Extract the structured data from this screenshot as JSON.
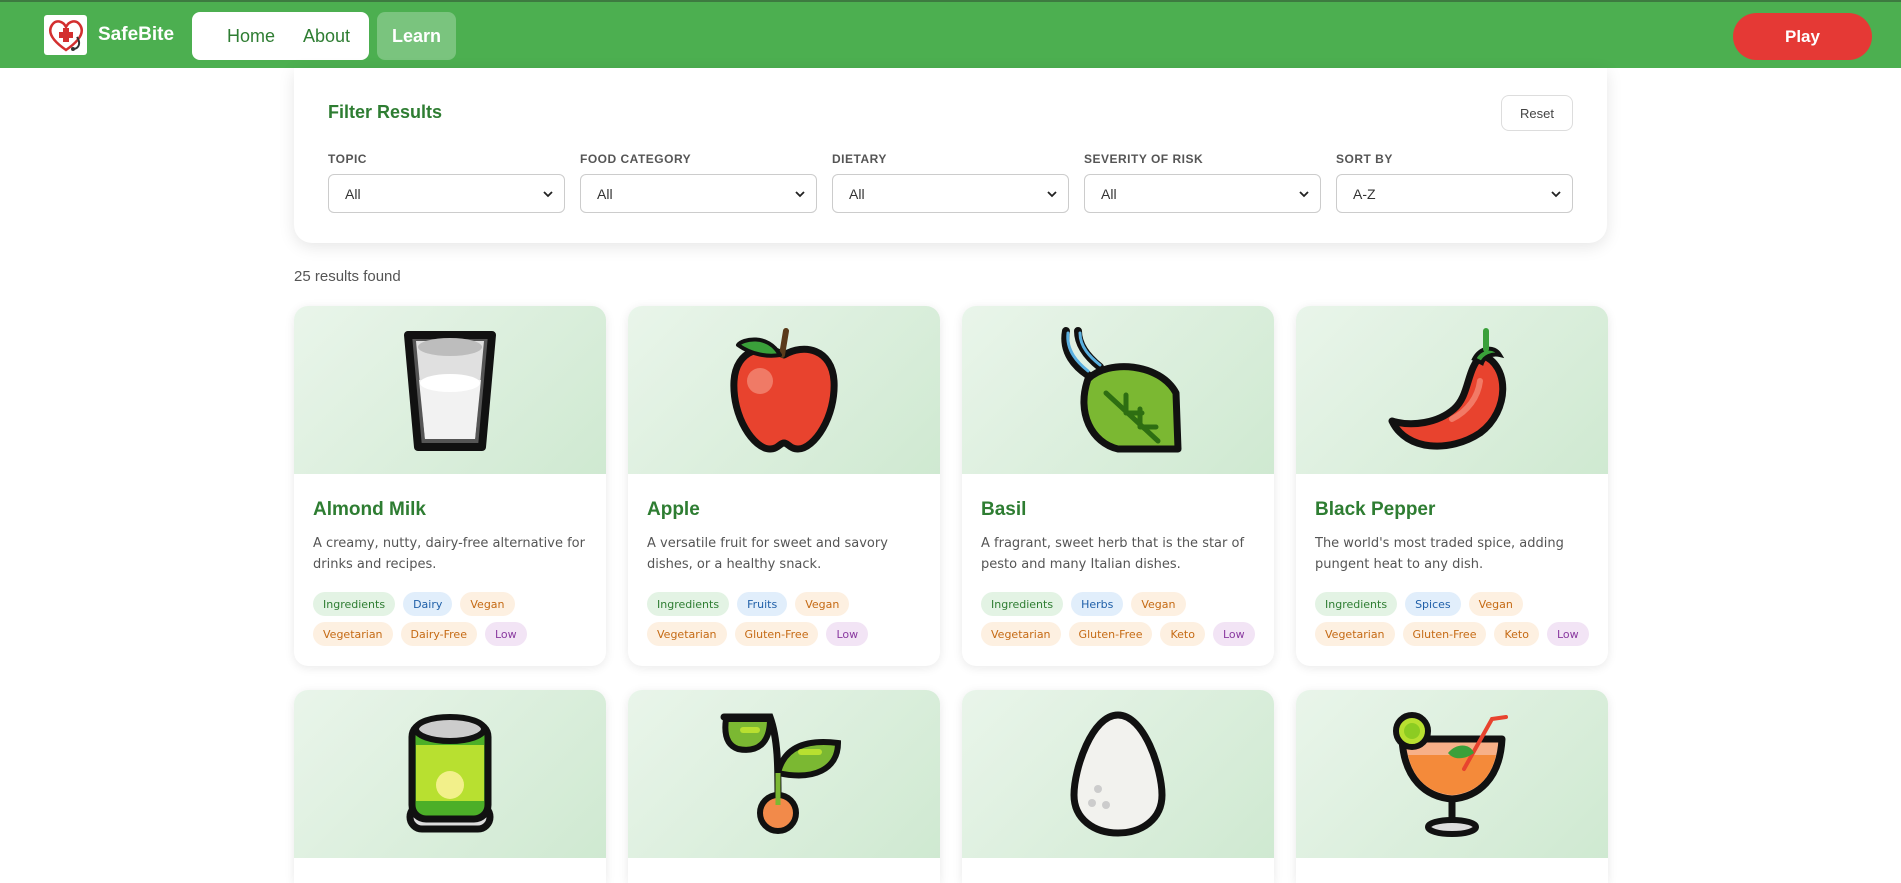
{
  "nav": {
    "brand": "SafeBite",
    "home": "Home",
    "about": "About",
    "learn": "Learn",
    "play": "Play"
  },
  "filters": {
    "title": "Filter Results",
    "reset": "Reset",
    "groups": [
      {
        "label": "TOPIC",
        "value": "All"
      },
      {
        "label": "FOOD CATEGORY",
        "value": "All"
      },
      {
        "label": "DIETARY",
        "value": "All"
      },
      {
        "label": "SEVERITY OF RISK",
        "value": "All"
      },
      {
        "label": "SORT BY",
        "value": "A-Z"
      }
    ]
  },
  "results": {
    "count_text": "25 results found"
  },
  "cards": [
    {
      "title": "Almond Milk",
      "desc": "A creamy, nutty, dairy-free alternative for drinks and recipes.",
      "tags": [
        "Ingredients",
        "Dairy",
        "Vegan",
        "Vegetarian",
        "Dairy-Free",
        "Low"
      ],
      "icon": "milk-glass-icon"
    },
    {
      "title": "Apple",
      "desc": "A versatile fruit for sweet and savory dishes, or a healthy snack.",
      "tags": [
        "Ingredients",
        "Fruits",
        "Vegan",
        "Vegetarian",
        "Gluten-Free",
        "Low"
      ],
      "icon": "apple-icon"
    },
    {
      "title": "Basil",
      "desc": "A fragrant, sweet herb that is the star of pesto and many Italian dishes.",
      "tags": [
        "Ingredients",
        "Herbs",
        "Vegan",
        "Vegetarian",
        "Gluten-Free",
        "Keto",
        "Low"
      ],
      "icon": "herb-leaf-icon"
    },
    {
      "title": "Black Pepper",
      "desc": "The world's most traded spice, adding pungent heat to any dish.",
      "tags": [
        "Ingredients",
        "Spices",
        "Vegan",
        "Vegetarian",
        "Gluten-Free",
        "Keto",
        "Low"
      ],
      "icon": "pepper-icon"
    },
    {
      "icon": "canned-food-icon"
    },
    {
      "icon": "sprout-icon"
    },
    {
      "icon": "egg-icon"
    },
    {
      "icon": "cocktail-icon"
    }
  ],
  "colors": {
    "nav_green": "#4caf50",
    "title_green": "#2e7d32",
    "play_red": "#e53935"
  }
}
